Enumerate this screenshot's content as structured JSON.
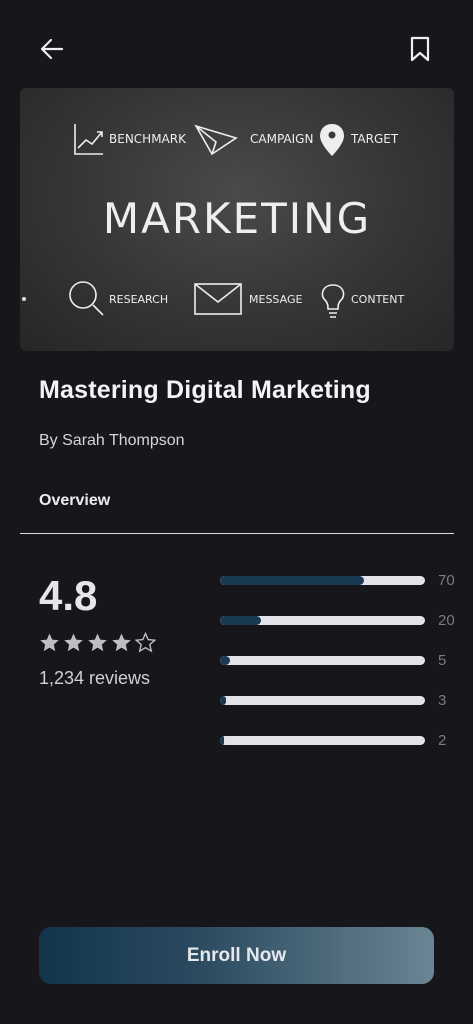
{
  "nav": {
    "back_icon": "arrow-left-icon",
    "bookmark_icon": "bookmark-icon"
  },
  "hero": {
    "headline": "MARKETING",
    "labels": {
      "benchmark": "BENCHMARK",
      "campaign": "CAMPAIGN",
      "target": "TARGET",
      "research": "RESEARCH",
      "message": "MESSAGE",
      "content": "CONTENT"
    }
  },
  "course": {
    "title": "Mastering Digital Marketing",
    "author": "By Sarah Thompson"
  },
  "tabs": {
    "overview": "Overview"
  },
  "rating": {
    "value": "4.8",
    "stars_filled": 4,
    "stars_total": 5,
    "reviews": "1,234 reviews",
    "distribution": [
      {
        "label": "70",
        "fraction": 0.7
      },
      {
        "label": "20",
        "fraction": 0.2
      },
      {
        "label": "5",
        "fraction": 0.05
      },
      {
        "label": "3",
        "fraction": 0.03
      },
      {
        "label": "2",
        "fraction": 0.02
      }
    ]
  },
  "cta": {
    "enroll_label": "Enroll Now"
  },
  "colors": {
    "background": "#17161a",
    "accent": "#173a52",
    "track": "#e3e2e8"
  }
}
